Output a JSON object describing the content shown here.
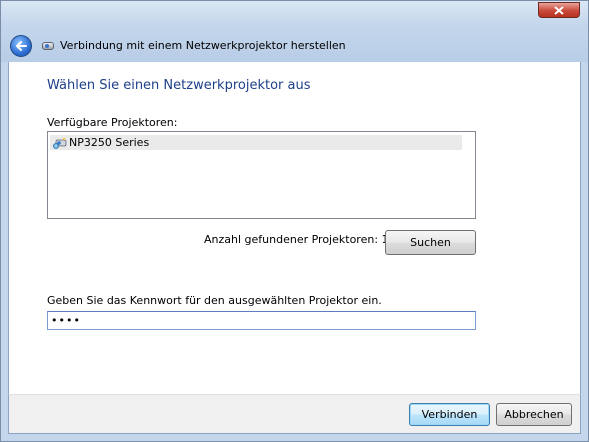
{
  "window": {
    "title": "Verbindung mit einem Netzwerkprojektor herstellen",
    "accent_color": "#1e3f8a"
  },
  "main": {
    "heading": "Wählen Sie einen Netzwerkprojektor aus",
    "available_label": "Verfügbare Projektoren:",
    "projectors": [
      {
        "name": "NP3250 Series",
        "icon": "network-projector-icon"
      }
    ],
    "found_count_label": "Anzahl gefundener Projektoren: 1",
    "search_button": "Suchen",
    "password_label": "Geben Sie das Kennwort für den ausgewählten Projektor ein.",
    "password_value": "••••"
  },
  "footer": {
    "connect_button": "Verbinden",
    "cancel_button": "Abbrechen"
  }
}
